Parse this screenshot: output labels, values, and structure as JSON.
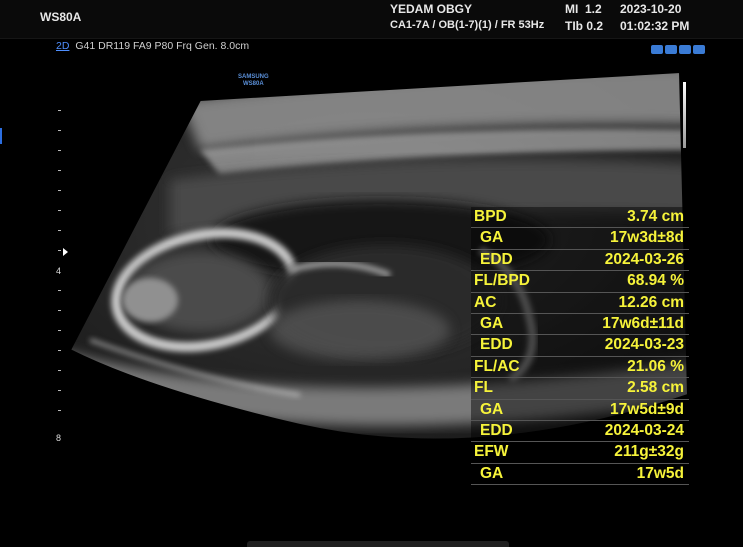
{
  "header": {
    "model": "WS80A",
    "institution": "YEDAM OBGY",
    "probe_info": "CA1-7A / OB(1-7)(1) / FR 53Hz",
    "mi": "MI  1.2",
    "tib": "TIb 0.2",
    "date": "2023-10-20",
    "time": "01:02:32 PM"
  },
  "image_params": {
    "mode": "2D",
    "settings": "G41 DR119 FA9 P80 Frq Gen. 8.0cm"
  },
  "watermark": [
    "SAMSUNG",
    "WS80A"
  ],
  "scale": {
    "labels": [
      "4",
      "8"
    ]
  },
  "measurements": [
    {
      "label": "BPD",
      "value": "3.74 cm",
      "sub": false
    },
    {
      "label": "GA",
      "value": "17w3d±8d",
      "sub": true
    },
    {
      "label": "EDD",
      "value": "2024-03-26",
      "sub": true
    },
    {
      "label": "FL/BPD",
      "value": "68.94 %",
      "sub": false
    },
    {
      "label": "AC",
      "value": "12.26 cm",
      "sub": false
    },
    {
      "label": "GA",
      "value": "17w6d±11d",
      "sub": true
    },
    {
      "label": "EDD",
      "value": "2024-03-23",
      "sub": true
    },
    {
      "label": "FL/AC",
      "value": "21.06 %",
      "sub": false
    },
    {
      "label": "FL",
      "value": "2.58 cm",
      "sub": false
    },
    {
      "label": "GA",
      "value": "17w5d±9d",
      "sub": true
    },
    {
      "label": "EDD",
      "value": "2024-03-24",
      "sub": true
    },
    {
      "label": "EFW",
      "value": "211g±32g",
      "sub": false
    },
    {
      "label": "GA",
      "value": "17w5d",
      "sub": true
    }
  ],
  "colors": {
    "measurement_text": "#f6f33a",
    "mode_link": "#4f8fff",
    "icon_blue": "#3a7bd5"
  }
}
